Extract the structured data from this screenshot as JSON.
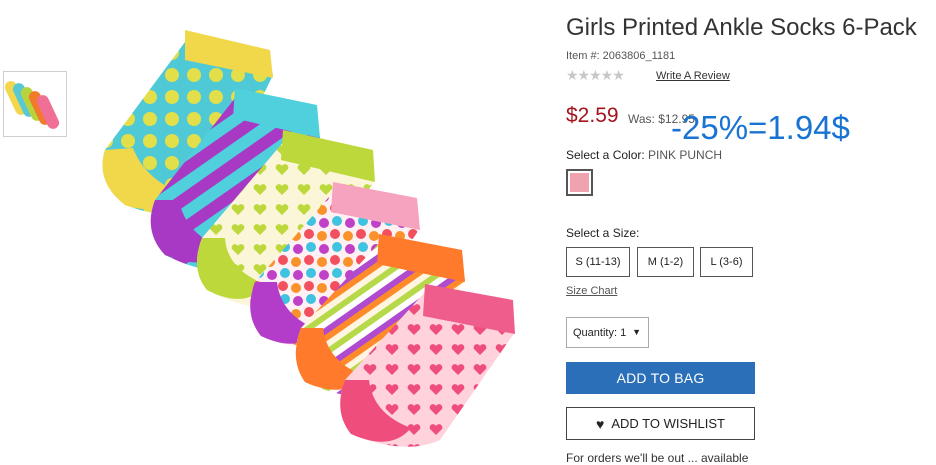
{
  "product": {
    "title": "Girls Printed Ankle Socks 6-Pack",
    "item_number": "Item #: 2063806_1181",
    "stars": "★★★★★",
    "review_link": "Write A Review",
    "price": "$2.59",
    "was_price": "Was: $12.95",
    "promo_note": "-25%=1.94$",
    "color_label": "Select a Color:",
    "color_value": "PINK PUNCH",
    "size_label": "Select a Size:",
    "sizes": [
      "S (11-13)",
      "M (1-2)",
      "L (3-6)"
    ],
    "size_chart": "Size Chart",
    "quantity": "Quantity: 1",
    "add_to_bag": "ADD TO BAG",
    "add_to_wishlist": "ADD TO WISHLIST",
    "footer_text": "For orders we'll be out ... available"
  }
}
